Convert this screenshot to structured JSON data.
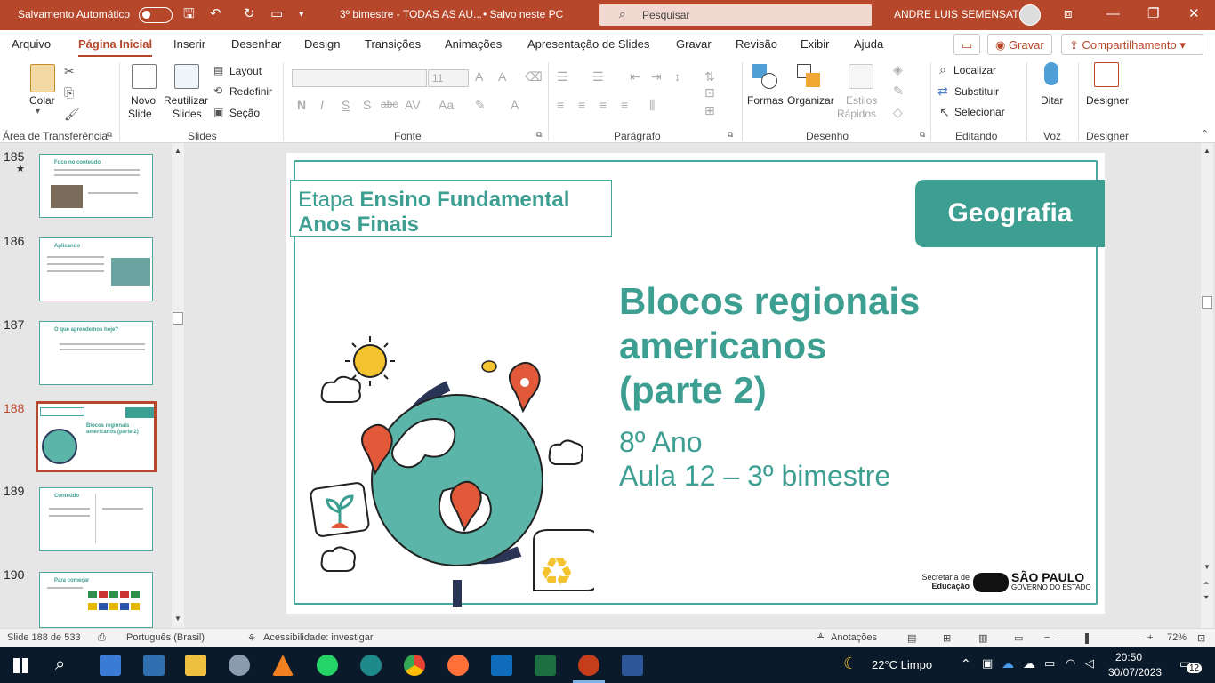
{
  "titlebar": {
    "autosave": "Salvamento Automático",
    "filename": "3º bimestre - TODAS AS AU...",
    "saved": "• Salvo neste PC",
    "search_placeholder": "Pesquisar",
    "user": "ANDRE LUIS SEMENSATO"
  },
  "tabs": [
    "Arquivo",
    "Página Inicial",
    "Inserir",
    "Desenhar",
    "Design",
    "Transições",
    "Animações",
    "Apresentação de Slides",
    "Gravar",
    "Revisão",
    "Exibir",
    "Ajuda"
  ],
  "record_button": "Gravar",
  "share_button": "Compartilhamento",
  "ribbon": {
    "paste": "Colar",
    "clipboard_group": "Área de Transferência",
    "new_slide_1": "Novo",
    "new_slide_2": "Slide",
    "reuse_1": "Reutilizar",
    "reuse_2": "Slides",
    "layout": "Layout",
    "reset": "Redefinir",
    "section": "Seção",
    "slides_group": "Slides",
    "font_size": "11",
    "font_group": "Fonte",
    "paragraph_group": "Parágrafo",
    "shapes": "Formas",
    "arrange": "Organizar",
    "quick_styles_1": "Estilos",
    "quick_styles_2": "Rápidos",
    "drawing_group": "Desenho",
    "find": "Localizar",
    "replace": "Substituir",
    "select": "Selecionar",
    "editing_group": "Editando",
    "dictate": "Ditar",
    "voice_group": "Voz",
    "designer": "Designer",
    "designer_group": "Designer"
  },
  "thumbnails": [
    {
      "num": "185",
      "title": "Foco no conteúdo"
    },
    {
      "num": "186",
      "title": "Aplicando"
    },
    {
      "num": "187",
      "title": "O que aprendemos hoje?"
    },
    {
      "num": "188",
      "title": "Blocos regionais americanos (parte 2)"
    },
    {
      "num": "189",
      "title": "Conteúdo"
    },
    {
      "num": "190",
      "title": "Para começar"
    }
  ],
  "slide": {
    "etapa_label": "Etapa",
    "etapa_bold": "Ensino Fundamental",
    "etapa_line2": "Anos Finais",
    "subject": "Geografia",
    "title_l1": "Blocos regionais",
    "title_l2": "americanos",
    "title_l3": "(parte 2)",
    "sub_l1": "8º Ano",
    "sub_l2": "Aula 12 – 3º bimestre",
    "logo_sec_1": "Secretaria de",
    "logo_sec_2": "Educação",
    "logo_sp": "SÃO PAULO",
    "logo_gov": "GOVERNO DO ESTADO"
  },
  "status": {
    "slide_pos": "Slide 188 de 533",
    "language": "Português (Brasil)",
    "accessibility": "Acessibilidade: investigar",
    "notes": "Anotações",
    "zoom": "72%"
  },
  "taskbar": {
    "weather": "22°C  Limpo",
    "time": "20:50",
    "date": "30/07/2023",
    "notif": "12"
  },
  "colors": {
    "accent": "#b7472a",
    "slide_teal": "#3d9e92"
  }
}
